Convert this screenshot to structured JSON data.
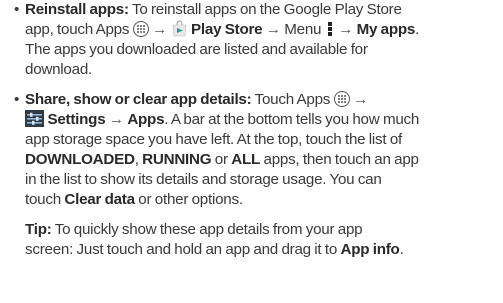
{
  "bullet": "•",
  "arrow": "→",
  "items": [
    {
      "title": "Reinstall apps:",
      "l1_a": " To reinstall apps on the Google Play Store",
      "l2_a": "app, touch Apps ",
      "l2_store": "Play Store",
      "l2_menu": " Menu ",
      "l2_myapps": "My apps",
      "l2_end": ".",
      "l3": "The apps you downloaded are listed and available for",
      "l4": "download."
    },
    {
      "title": "Share, show or clear app details:",
      "l1_a": " Touch Apps ",
      "l2_settings": "Settings",
      "l2_apps": "Apps",
      "l2_b": ". A bar at the bottom tells you how much",
      "l3": "app storage space you have left. At the top, touch the list of",
      "l4_downloaded": "DOWNLOADED",
      "l4_sep1": ", ",
      "l4_running": "RUNNING",
      "l4_or": " or ",
      "l4_all": "ALL",
      "l4_end": " apps, then touch an app",
      "l5": "in the list to show its details and storage usage. You can",
      "l6_a": "touch ",
      "l6_clear": "Clear data",
      "l6_b": " or other options."
    }
  ],
  "tip": {
    "label": "Tip:",
    "l1": " To quickly show these app details from your app",
    "l2_a": "screen: Just touch and hold an app and drag it to ",
    "l2_appinfo": "App info",
    "l2_end": "."
  }
}
